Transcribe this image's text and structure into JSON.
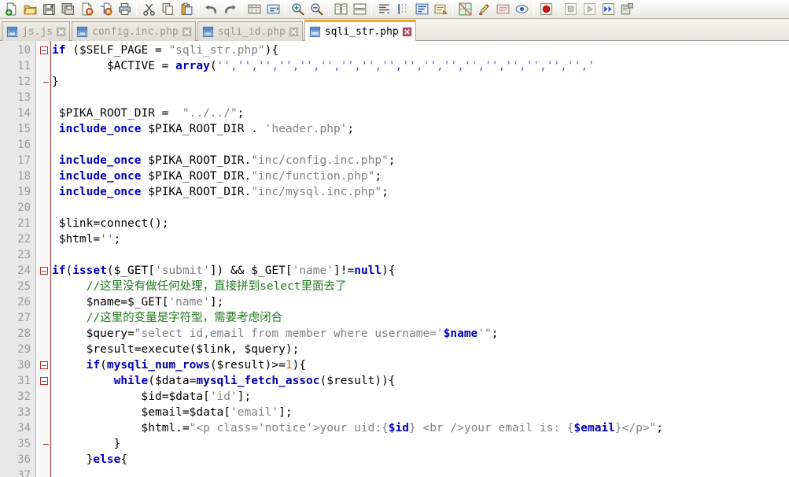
{
  "toolbar": {
    "buttons": [
      {
        "name": "new-file-icon",
        "label": "New"
      },
      {
        "name": "open-folder-icon",
        "label": "Open"
      },
      {
        "name": "save-icon",
        "label": "Save"
      },
      {
        "name": "save-all-icon",
        "label": "Save All"
      },
      {
        "name": "close-file-icon",
        "label": "Close"
      },
      {
        "name": "close-all-icon",
        "label": "Close All"
      },
      {
        "name": "print-icon",
        "label": "Print"
      },
      {
        "name": "cut-icon",
        "label": "Cut"
      },
      {
        "name": "copy-icon",
        "label": "Copy"
      },
      {
        "name": "paste-icon",
        "label": "Paste"
      },
      {
        "name": "undo-icon",
        "label": "Undo"
      },
      {
        "name": "redo-icon",
        "label": "Redo"
      },
      {
        "name": "find-icon",
        "label": "Find"
      },
      {
        "name": "replace-icon",
        "label": "Replace"
      },
      {
        "name": "zoom-in-icon",
        "label": "Zoom In"
      },
      {
        "name": "zoom-out-icon",
        "label": "Zoom Out"
      },
      {
        "name": "sync-scroll-icon",
        "label": "Sync Vertical Scrolling"
      },
      {
        "name": "sync-scroll-h-icon",
        "label": "Sync Horizontal Scrolling"
      },
      {
        "name": "show-whitespace-icon",
        "label": "Show All Characters"
      },
      {
        "name": "indent-guide-icon",
        "label": "Show Indent Guide"
      },
      {
        "name": "word-wrap-icon",
        "label": "Word Wrap"
      },
      {
        "name": "user-language-icon",
        "label": "User Defined Language"
      },
      {
        "name": "color-picker-icon",
        "label": "Color Picker"
      },
      {
        "name": "marker-icon",
        "label": "Marker"
      },
      {
        "name": "document-map-icon",
        "label": "Document Map"
      },
      {
        "name": "function-list-icon",
        "label": "Function List"
      },
      {
        "name": "record-macro-icon",
        "label": "Start Recording"
      },
      {
        "name": "stop-macro-icon",
        "label": "Stop Recording"
      },
      {
        "name": "play-macro-icon",
        "label": "Playback"
      },
      {
        "name": "play-multiple-icon",
        "label": "Run Multiple Times"
      },
      {
        "name": "save-macro-icon",
        "label": "Save Current Macro"
      }
    ],
    "separators_after": [
      6,
      9,
      11,
      13,
      15,
      17,
      21,
      25,
      26
    ]
  },
  "tabs": [
    {
      "label": "js.js",
      "active": false,
      "modified": false
    },
    {
      "label": "config.inc.php",
      "active": false,
      "modified": false
    },
    {
      "label": "sqli_id.php",
      "active": false,
      "modified": false
    },
    {
      "label": "sqli_str.php",
      "active": true,
      "modified": false
    }
  ],
  "colors": {
    "active_tab_accent": "#f5a623",
    "keyword": "#0000c0",
    "string": "#808080",
    "comment": "#1f7a1f",
    "number": "#c07000",
    "quote": "#7a4fc0",
    "gutter_bg": "#e8e8e8",
    "fold_marker": "#b03030"
  },
  "editor": {
    "first_line_number": 10,
    "last_line_number": 37,
    "fold_open_lines": [
      10,
      24,
      30,
      31
    ],
    "fold_end_lines": [
      12,
      35
    ],
    "lines": [
      {
        "n": 10,
        "tokens": [
          {
            "t": "if",
            "c": "kw"
          },
          {
            "t": " (",
            "c": "op"
          },
          {
            "t": "$SELF_PAGE",
            "c": "var"
          },
          {
            "t": " = ",
            "c": "op"
          },
          {
            "t": "\"sqli_str.php\"",
            "c": "str"
          },
          {
            "t": "){",
            "c": "op"
          }
        ]
      },
      {
        "n": 11,
        "tokens": [
          {
            "t": "        ",
            "c": "plain"
          },
          {
            "t": "$ACTIVE",
            "c": "var"
          },
          {
            "t": " = ",
            "c": "op"
          },
          {
            "t": "array",
            "c": "kw"
          },
          {
            "t": "(",
            "c": "op"
          },
          {
            "t": "''",
            "c": "qt"
          },
          {
            "t": ",",
            "c": "qt"
          },
          {
            "t": "''",
            "c": "qt"
          },
          {
            "t": ",",
            "c": "qt"
          },
          {
            "t": "''",
            "c": "qt"
          },
          {
            "t": ",",
            "c": "qt"
          },
          {
            "t": "''",
            "c": "qt"
          },
          {
            "t": ",",
            "c": "qt"
          },
          {
            "t": "''",
            "c": "qt"
          },
          {
            "t": ",",
            "c": "qt"
          },
          {
            "t": "''",
            "c": "qt"
          },
          {
            "t": ",",
            "c": "qt"
          },
          {
            "t": "''",
            "c": "qt"
          },
          {
            "t": ",",
            "c": "qt"
          },
          {
            "t": "''",
            "c": "qt"
          },
          {
            "t": ",",
            "c": "qt"
          },
          {
            "t": "''",
            "c": "qt"
          },
          {
            "t": ",",
            "c": "qt"
          },
          {
            "t": "''",
            "c": "qt"
          },
          {
            "t": ",",
            "c": "qt"
          },
          {
            "t": "''",
            "c": "qt"
          },
          {
            "t": ",",
            "c": "qt"
          },
          {
            "t": "''",
            "c": "qt"
          },
          {
            "t": ",",
            "c": "qt"
          },
          {
            "t": "''",
            "c": "qt"
          },
          {
            "t": ",",
            "c": "qt"
          },
          {
            "t": "''",
            "c": "qt"
          },
          {
            "t": ",",
            "c": "qt"
          },
          {
            "t": "''",
            "c": "qt"
          },
          {
            "t": ",",
            "c": "qt"
          },
          {
            "t": "''",
            "c": "qt"
          },
          {
            "t": ",",
            "c": "qt"
          },
          {
            "t": "''",
            "c": "qt"
          },
          {
            "t": ",",
            "c": "qt"
          },
          {
            "t": "''",
            "c": "qt"
          },
          {
            "t": ",",
            "c": "qt"
          },
          {
            "t": "'",
            "c": "qt"
          }
        ]
      },
      {
        "n": 12,
        "tokens": [
          {
            "t": "}",
            "c": "op"
          }
        ]
      },
      {
        "n": 13,
        "tokens": []
      },
      {
        "n": 14,
        "tokens": [
          {
            "t": " ",
            "c": "plain"
          },
          {
            "t": "$PIKA_ROOT_DIR",
            "c": "var"
          },
          {
            "t": " = ",
            "c": "op"
          },
          {
            "t": " \"../../\"",
            "c": "str"
          },
          {
            "t": ";",
            "c": "op"
          }
        ]
      },
      {
        "n": 15,
        "tokens": [
          {
            "t": " ",
            "c": "plain"
          },
          {
            "t": "include_once",
            "c": "kw"
          },
          {
            "t": " ",
            "c": "plain"
          },
          {
            "t": "$PIKA_ROOT_DIR",
            "c": "var"
          },
          {
            "t": " . ",
            "c": "op"
          },
          {
            "t": "'header.php'",
            "c": "str"
          },
          {
            "t": ";",
            "c": "op"
          }
        ]
      },
      {
        "n": 16,
        "tokens": []
      },
      {
        "n": 17,
        "tokens": [
          {
            "t": " ",
            "c": "plain"
          },
          {
            "t": "include_once",
            "c": "kw"
          },
          {
            "t": " ",
            "c": "plain"
          },
          {
            "t": "$PIKA_ROOT_DIR",
            "c": "var"
          },
          {
            "t": ".",
            "c": "op"
          },
          {
            "t": "\"inc/config.inc.php\"",
            "c": "str"
          },
          {
            "t": ";",
            "c": "op"
          }
        ]
      },
      {
        "n": 18,
        "tokens": [
          {
            "t": " ",
            "c": "plain"
          },
          {
            "t": "include_once",
            "c": "kw"
          },
          {
            "t": " ",
            "c": "plain"
          },
          {
            "t": "$PIKA_ROOT_DIR",
            "c": "var"
          },
          {
            "t": ".",
            "c": "op"
          },
          {
            "t": "\"inc/function.php\"",
            "c": "str"
          },
          {
            "t": ";",
            "c": "op"
          }
        ]
      },
      {
        "n": 19,
        "tokens": [
          {
            "t": " ",
            "c": "plain"
          },
          {
            "t": "include_once",
            "c": "kw"
          },
          {
            "t": " ",
            "c": "plain"
          },
          {
            "t": "$PIKA_ROOT_DIR",
            "c": "var"
          },
          {
            "t": ".",
            "c": "op"
          },
          {
            "t": "\"inc/mysql.inc.php\"",
            "c": "str"
          },
          {
            "t": ";",
            "c": "op"
          }
        ]
      },
      {
        "n": 20,
        "tokens": []
      },
      {
        "n": 21,
        "tokens": [
          {
            "t": " ",
            "c": "plain"
          },
          {
            "t": "$link",
            "c": "var"
          },
          {
            "t": "=",
            "c": "op"
          },
          {
            "t": "connect",
            "c": "plain"
          },
          {
            "t": "();",
            "c": "op"
          }
        ]
      },
      {
        "n": 22,
        "tokens": [
          {
            "t": " ",
            "c": "plain"
          },
          {
            "t": "$html",
            "c": "var"
          },
          {
            "t": "=",
            "c": "op"
          },
          {
            "t": "''",
            "c": "qt"
          },
          {
            "t": ";",
            "c": "op"
          }
        ]
      },
      {
        "n": 23,
        "tokens": []
      },
      {
        "n": 24,
        "tokens": [
          {
            "t": "if",
            "c": "kw"
          },
          {
            "t": "(",
            "c": "op"
          },
          {
            "t": "isset",
            "c": "kw"
          },
          {
            "t": "(",
            "c": "op"
          },
          {
            "t": "$_GET",
            "c": "var"
          },
          {
            "t": "[",
            "c": "op"
          },
          {
            "t": "'submit'",
            "c": "str"
          },
          {
            "t": "]) ",
            "c": "op"
          },
          {
            "t": "&&",
            "c": "op"
          },
          {
            "t": " ",
            "c": "plain"
          },
          {
            "t": "$_GET",
            "c": "var"
          },
          {
            "t": "[",
            "c": "op"
          },
          {
            "t": "'name'",
            "c": "str"
          },
          {
            "t": "]!=",
            "c": "op"
          },
          {
            "t": "null",
            "c": "kw"
          },
          {
            "t": "){",
            "c": "op"
          }
        ]
      },
      {
        "n": 25,
        "tokens": [
          {
            "t": "     ",
            "c": "plain"
          },
          {
            "t": "//这里没有做任何处理，直接拼到select里面去了",
            "c": "cmt"
          }
        ]
      },
      {
        "n": 26,
        "tokens": [
          {
            "t": "     ",
            "c": "plain"
          },
          {
            "t": "$name",
            "c": "var"
          },
          {
            "t": "=",
            "c": "op"
          },
          {
            "t": "$_GET",
            "c": "var"
          },
          {
            "t": "[",
            "c": "op"
          },
          {
            "t": "'name'",
            "c": "str"
          },
          {
            "t": "];",
            "c": "op"
          }
        ]
      },
      {
        "n": 27,
        "tokens": [
          {
            "t": "     ",
            "c": "plain"
          },
          {
            "t": "//这里的变量是字符型，需要考虑闭合",
            "c": "cmt"
          }
        ]
      },
      {
        "n": 28,
        "tokens": [
          {
            "t": "     ",
            "c": "plain"
          },
          {
            "t": "$query",
            "c": "var"
          },
          {
            "t": "=",
            "c": "op"
          },
          {
            "t": "\"select id,email from member where username='",
            "c": "str"
          },
          {
            "t": "$name",
            "c": "kw"
          },
          {
            "t": "'\"",
            "c": "str"
          },
          {
            "t": ";",
            "c": "op"
          }
        ]
      },
      {
        "n": 29,
        "tokens": [
          {
            "t": "     ",
            "c": "plain"
          },
          {
            "t": "$result",
            "c": "var"
          },
          {
            "t": "=",
            "c": "op"
          },
          {
            "t": "execute",
            "c": "plain"
          },
          {
            "t": "(",
            "c": "op"
          },
          {
            "t": "$link",
            "c": "var"
          },
          {
            "t": ", ",
            "c": "op"
          },
          {
            "t": "$query",
            "c": "var"
          },
          {
            "t": ");",
            "c": "op"
          }
        ]
      },
      {
        "n": 30,
        "tokens": [
          {
            "t": "     ",
            "c": "plain"
          },
          {
            "t": "if",
            "c": "kw"
          },
          {
            "t": "(",
            "c": "op"
          },
          {
            "t": "mysqli_num_rows",
            "c": "fn"
          },
          {
            "t": "(",
            "c": "op"
          },
          {
            "t": "$result",
            "c": "var"
          },
          {
            "t": ")>=",
            "c": "op"
          },
          {
            "t": "1",
            "c": "num"
          },
          {
            "t": "){",
            "c": "op"
          }
        ]
      },
      {
        "n": 31,
        "tokens": [
          {
            "t": "         ",
            "c": "plain"
          },
          {
            "t": "while",
            "c": "kw"
          },
          {
            "t": "(",
            "c": "op"
          },
          {
            "t": "$data",
            "c": "var"
          },
          {
            "t": "=",
            "c": "op"
          },
          {
            "t": "mysqli_fetch_assoc",
            "c": "fn"
          },
          {
            "t": "(",
            "c": "op"
          },
          {
            "t": "$result",
            "c": "var"
          },
          {
            "t": ")){",
            "c": "op"
          }
        ]
      },
      {
        "n": 32,
        "tokens": [
          {
            "t": "             ",
            "c": "plain"
          },
          {
            "t": "$id",
            "c": "var"
          },
          {
            "t": "=",
            "c": "op"
          },
          {
            "t": "$data",
            "c": "var"
          },
          {
            "t": "[",
            "c": "op"
          },
          {
            "t": "'id'",
            "c": "str"
          },
          {
            "t": "];",
            "c": "op"
          }
        ]
      },
      {
        "n": 33,
        "tokens": [
          {
            "t": "             ",
            "c": "plain"
          },
          {
            "t": "$email",
            "c": "var"
          },
          {
            "t": "=",
            "c": "op"
          },
          {
            "t": "$data",
            "c": "var"
          },
          {
            "t": "[",
            "c": "op"
          },
          {
            "t": "'email'",
            "c": "str"
          },
          {
            "t": "];",
            "c": "op"
          }
        ]
      },
      {
        "n": 34,
        "tokens": [
          {
            "t": "             ",
            "c": "plain"
          },
          {
            "t": "$html",
            "c": "var"
          },
          {
            "t": ".=",
            "c": "op"
          },
          {
            "t": "\"<p class='notice'>your uid:{",
            "c": "str"
          },
          {
            "t": "$id",
            "c": "kw"
          },
          {
            "t": "} <br />your email is: {",
            "c": "str"
          },
          {
            "t": "$email",
            "c": "kw"
          },
          {
            "t": "}</p>\"",
            "c": "str"
          },
          {
            "t": ";",
            "c": "op"
          }
        ]
      },
      {
        "n": 35,
        "tokens": [
          {
            "t": "         ",
            "c": "plain"
          },
          {
            "t": "}",
            "c": "op"
          }
        ]
      },
      {
        "n": 36,
        "tokens": [
          {
            "t": "     ",
            "c": "plain"
          },
          {
            "t": "}",
            "c": "op"
          },
          {
            "t": "else",
            "c": "kw"
          },
          {
            "t": "{",
            "c": "op"
          }
        ]
      },
      {
        "n": 37,
        "tokens": []
      }
    ]
  }
}
